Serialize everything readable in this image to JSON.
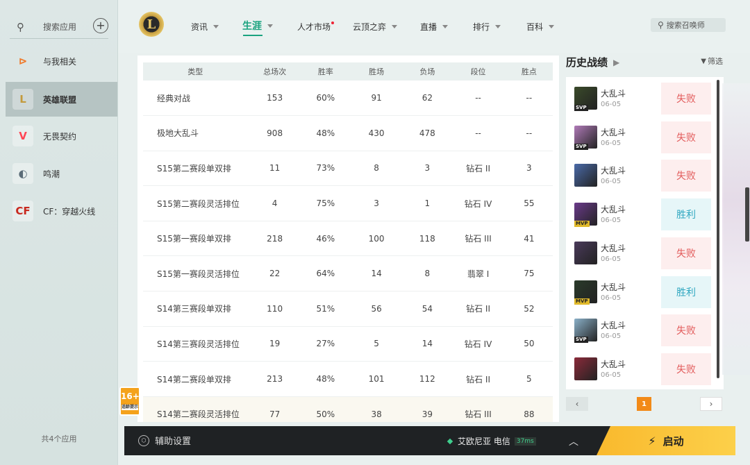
{
  "sidebar": {
    "search_placeholder": "搜索应用",
    "add_icon": "plus-icon",
    "items": [
      {
        "label": "与我相关",
        "icon": "related-icon",
        "color": "#f07a2a"
      },
      {
        "label": "英雄联盟",
        "icon": "lol-icon",
        "color": "#c39a3c"
      },
      {
        "label": "无畏契约",
        "icon": "valorant-icon",
        "color": "#ff4655"
      },
      {
        "label": "鸣潮",
        "icon": "wuthering-icon",
        "color": "#5b6c78"
      },
      {
        "label": "CF：穿越火线",
        "icon": "cf-icon",
        "color": "#c8281e"
      }
    ],
    "footer": "共4个应用"
  },
  "topnav": {
    "items": [
      {
        "label": "资讯"
      },
      {
        "label": "生涯"
      },
      {
        "label": "人才市场"
      },
      {
        "label": "云顶之弈"
      },
      {
        "label": "直播"
      },
      {
        "label": "排行"
      },
      {
        "label": "百科"
      }
    ],
    "search_placeholder": "搜索召唤师"
  },
  "stats": {
    "headers": [
      "类型",
      "总场次",
      "胜率",
      "胜场",
      "负场",
      "段位",
      "胜点"
    ],
    "rows": [
      [
        "经典对战",
        "153",
        "60%",
        "91",
        "62",
        "--",
        "--"
      ],
      [
        "极地大乱斗",
        "908",
        "48%",
        "430",
        "478",
        "--",
        "--"
      ],
      [
        "S15第二赛段单双排",
        "11",
        "73%",
        "8",
        "3",
        "钻石 II",
        "3"
      ],
      [
        "S15第二赛段灵活排位",
        "4",
        "75%",
        "3",
        "1",
        "钻石 IV",
        "55"
      ],
      [
        "S15第一赛段单双排",
        "218",
        "46%",
        "100",
        "118",
        "钻石 III",
        "41"
      ],
      [
        "S15第一赛段灵活排位",
        "22",
        "64%",
        "14",
        "8",
        "翡翠 I",
        "75"
      ],
      [
        "S14第三赛段单双排",
        "110",
        "51%",
        "56",
        "54",
        "钻石 II",
        "52"
      ],
      [
        "S14第三赛段灵活排位",
        "19",
        "27%",
        "5",
        "14",
        "钻石 IV",
        "50"
      ],
      [
        "S14第二赛段单双排",
        "213",
        "48%",
        "101",
        "112",
        "钻石 II",
        "5"
      ],
      [
        "S14第二赛段灵活排位",
        "77",
        "50%",
        "38",
        "39",
        "钻石 III",
        "88"
      ]
    ]
  },
  "history": {
    "title": "历史战绩",
    "filter": "筛选",
    "matches": [
      {
        "mode": "大乱斗",
        "date": "06-05",
        "badge": "SVP",
        "result": "失败",
        "outcome": "lose",
        "color": "#3a4a2a"
      },
      {
        "mode": "大乱斗",
        "date": "06-05",
        "badge": "SVP",
        "result": "失败",
        "outcome": "lose",
        "color": "#b07ab8"
      },
      {
        "mode": "大乱斗",
        "date": "06-05",
        "badge": "",
        "result": "失败",
        "outcome": "lose",
        "color": "#4a6aa8"
      },
      {
        "mode": "大乱斗",
        "date": "06-05",
        "badge": "MVP",
        "result": "胜利",
        "outcome": "win",
        "color": "#6a3a8a"
      },
      {
        "mode": "大乱斗",
        "date": "06-05",
        "badge": "",
        "result": "失败",
        "outcome": "lose",
        "color": "#4a3a5a"
      },
      {
        "mode": "大乱斗",
        "date": "06-05",
        "badge": "MVP",
        "result": "胜利",
        "outcome": "win",
        "color": "#2a3a2a"
      },
      {
        "mode": "大乱斗",
        "date": "06-05",
        "badge": "SVP",
        "result": "失败",
        "outcome": "lose",
        "color": "#8ab0c8"
      },
      {
        "mode": "大乱斗",
        "date": "06-05",
        "badge": "",
        "result": "失败",
        "outcome": "lose",
        "color": "#8a2a3a"
      }
    ],
    "page": "1",
    "prev": "‹",
    "next": "›"
  },
  "age_rating": {
    "value": "16+",
    "note": "适龄提示"
  },
  "bottombar": {
    "assist_label": "辅助设置",
    "server": "艾欧尼亚 电信",
    "ping": "37ms",
    "launch_label": "启动"
  }
}
